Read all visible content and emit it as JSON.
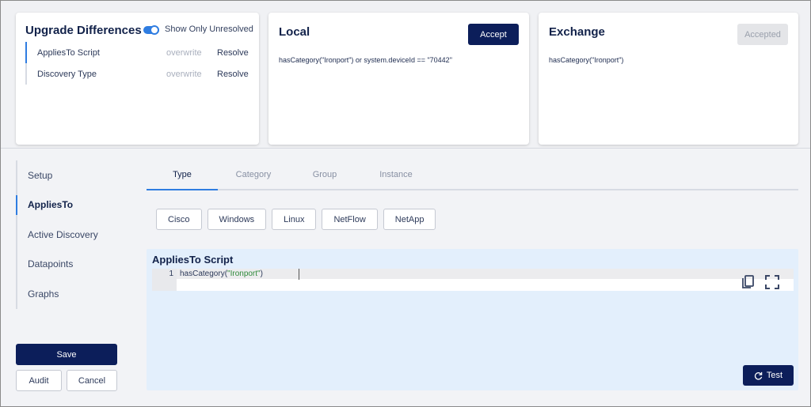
{
  "upgrade": {
    "title": "Upgrade Differences",
    "toggle_label": "Show Only Unresolved",
    "toggle_on": true,
    "rows": [
      {
        "name": "AppliesTo Script",
        "action": "overwrite",
        "resolve": "Resolve"
      },
      {
        "name": "Discovery Type",
        "action": "overwrite",
        "resolve": "Resolve"
      }
    ]
  },
  "local": {
    "title": "Local",
    "accept_label": "Accept",
    "code": "hasCategory(\"Ironport\") or system.deviceId == \"70442\""
  },
  "exchange": {
    "title": "Exchange",
    "accept_label": "Accepted",
    "code": "hasCategory(\"Ironport\")"
  },
  "sidebar": {
    "items": [
      {
        "label": "Setup"
      },
      {
        "label": "AppliesTo"
      },
      {
        "label": "Active Discovery"
      },
      {
        "label": "Datapoints"
      },
      {
        "label": "Graphs"
      }
    ],
    "active_index": 1
  },
  "actions": {
    "save_label": "Save",
    "audit_label": "Audit",
    "cancel_label": "Cancel"
  },
  "tabs": [
    {
      "label": "Type"
    },
    {
      "label": "Category"
    },
    {
      "label": "Group"
    },
    {
      "label": "Instance"
    }
  ],
  "chips": [
    {
      "label": "Cisco"
    },
    {
      "label": "Windows"
    },
    {
      "label": "Linux"
    },
    {
      "label": "NetFlow"
    },
    {
      "label": "NetApp"
    }
  ],
  "script": {
    "title": "AppliesTo Script",
    "line_number": "1",
    "code_prefix": "hasCategory(",
    "code_string": "\"Ironport\"",
    "code_suffix": ")",
    "test_label": "Test"
  },
  "colors": {
    "primary": "#0c1e5a",
    "accent": "#2f7de1",
    "panel": "#e3effc"
  }
}
